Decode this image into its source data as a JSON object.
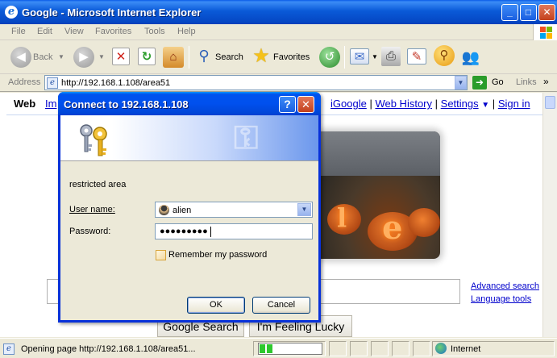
{
  "window": {
    "title": "Google - Microsoft Internet Explorer",
    "buttons": {
      "minimize": "_",
      "maximize": "□",
      "close": "✕"
    }
  },
  "menu": [
    "File",
    "Edit",
    "View",
    "Favorites",
    "Tools",
    "Help"
  ],
  "toolbar": {
    "back": "Back",
    "search": "Search",
    "favorites": "Favorites",
    "icons": [
      "back-icon",
      "forward-icon",
      "stop-icon",
      "refresh-icon",
      "home-icon",
      "search-icon",
      "favorites-star-icon",
      "history-icon",
      "mail-icon",
      "print-icon",
      "edit-icon",
      "research-icon",
      "messenger-icon"
    ]
  },
  "address": {
    "label": "Address",
    "url": "http://192.168.1.108/area51",
    "go": "Go",
    "links": "Links",
    "chevron": "»"
  },
  "google": {
    "nav_web": "Web",
    "nav_images_partial": "Im",
    "toplinks": [
      "iGoogle",
      "Web History",
      "Settings",
      "Sign in"
    ],
    "separator": "|",
    "settings_caret": "▼",
    "advanced_search": "Advanced search",
    "language_tools": "Language tools",
    "btn_search": "Google Search",
    "btn_lucky": "I'm Feeling Lucky",
    "logo_letters": [
      "l",
      "e"
    ]
  },
  "dialog": {
    "title": "Connect to 192.168.1.108",
    "help": "?",
    "close": "✕",
    "realm": "restricted area",
    "username_label": "User name:",
    "username_value": "alien",
    "password_label": "Password:",
    "password_value": "●●●●●●●●●",
    "remember": "Remember my password",
    "remember_checked": false,
    "ok": "OK",
    "cancel": "Cancel"
  },
  "status": {
    "text": "Opening page http://192.168.1.108/area51...",
    "progress_segments": 2,
    "zone": "Internet"
  },
  "colors": {
    "xp_blue": "#0053ee",
    "link": "#0000cc",
    "progress": "#2ec82e"
  }
}
